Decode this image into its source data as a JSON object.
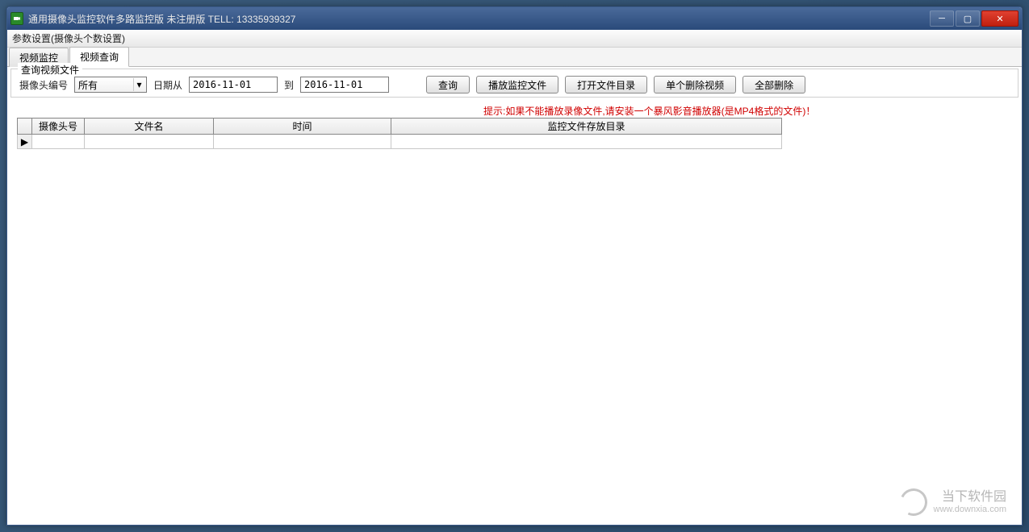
{
  "window": {
    "title": "通用摄像头监控软件多路监控版 未注册版 TELL: 13335939327"
  },
  "menubar": {
    "settings_label": "参数设置(摄像头个数设置)"
  },
  "tabs": [
    {
      "label": "视频监控",
      "active": false
    },
    {
      "label": "视频查询",
      "active": true
    }
  ],
  "query": {
    "legend": "查询视频文件",
    "camera_label": "摄像头编号",
    "camera_value": "所有",
    "date_from_label": "日期从",
    "date_from_value": "2016-11-01",
    "date_to_label": "到",
    "date_to_value": "2016-11-01",
    "buttons": {
      "query": "查询",
      "play": "播放监控文件",
      "open_dir": "打开文件目录",
      "delete_single": "单个删除视频",
      "delete_all": "全部删除"
    },
    "hint": "提示:如果不能播放录像文件,请安装一个暴风影音播放器(是MP4格式的文件)！"
  },
  "table": {
    "columns": {
      "cam_no": "摄像头号",
      "filename": "文件名",
      "time": "时间",
      "dir": "监控文件存放目录"
    },
    "row_indicator": "▶",
    "rows": []
  },
  "watermark": {
    "site_name": "当下软件园",
    "url": "www.downxia.com"
  }
}
